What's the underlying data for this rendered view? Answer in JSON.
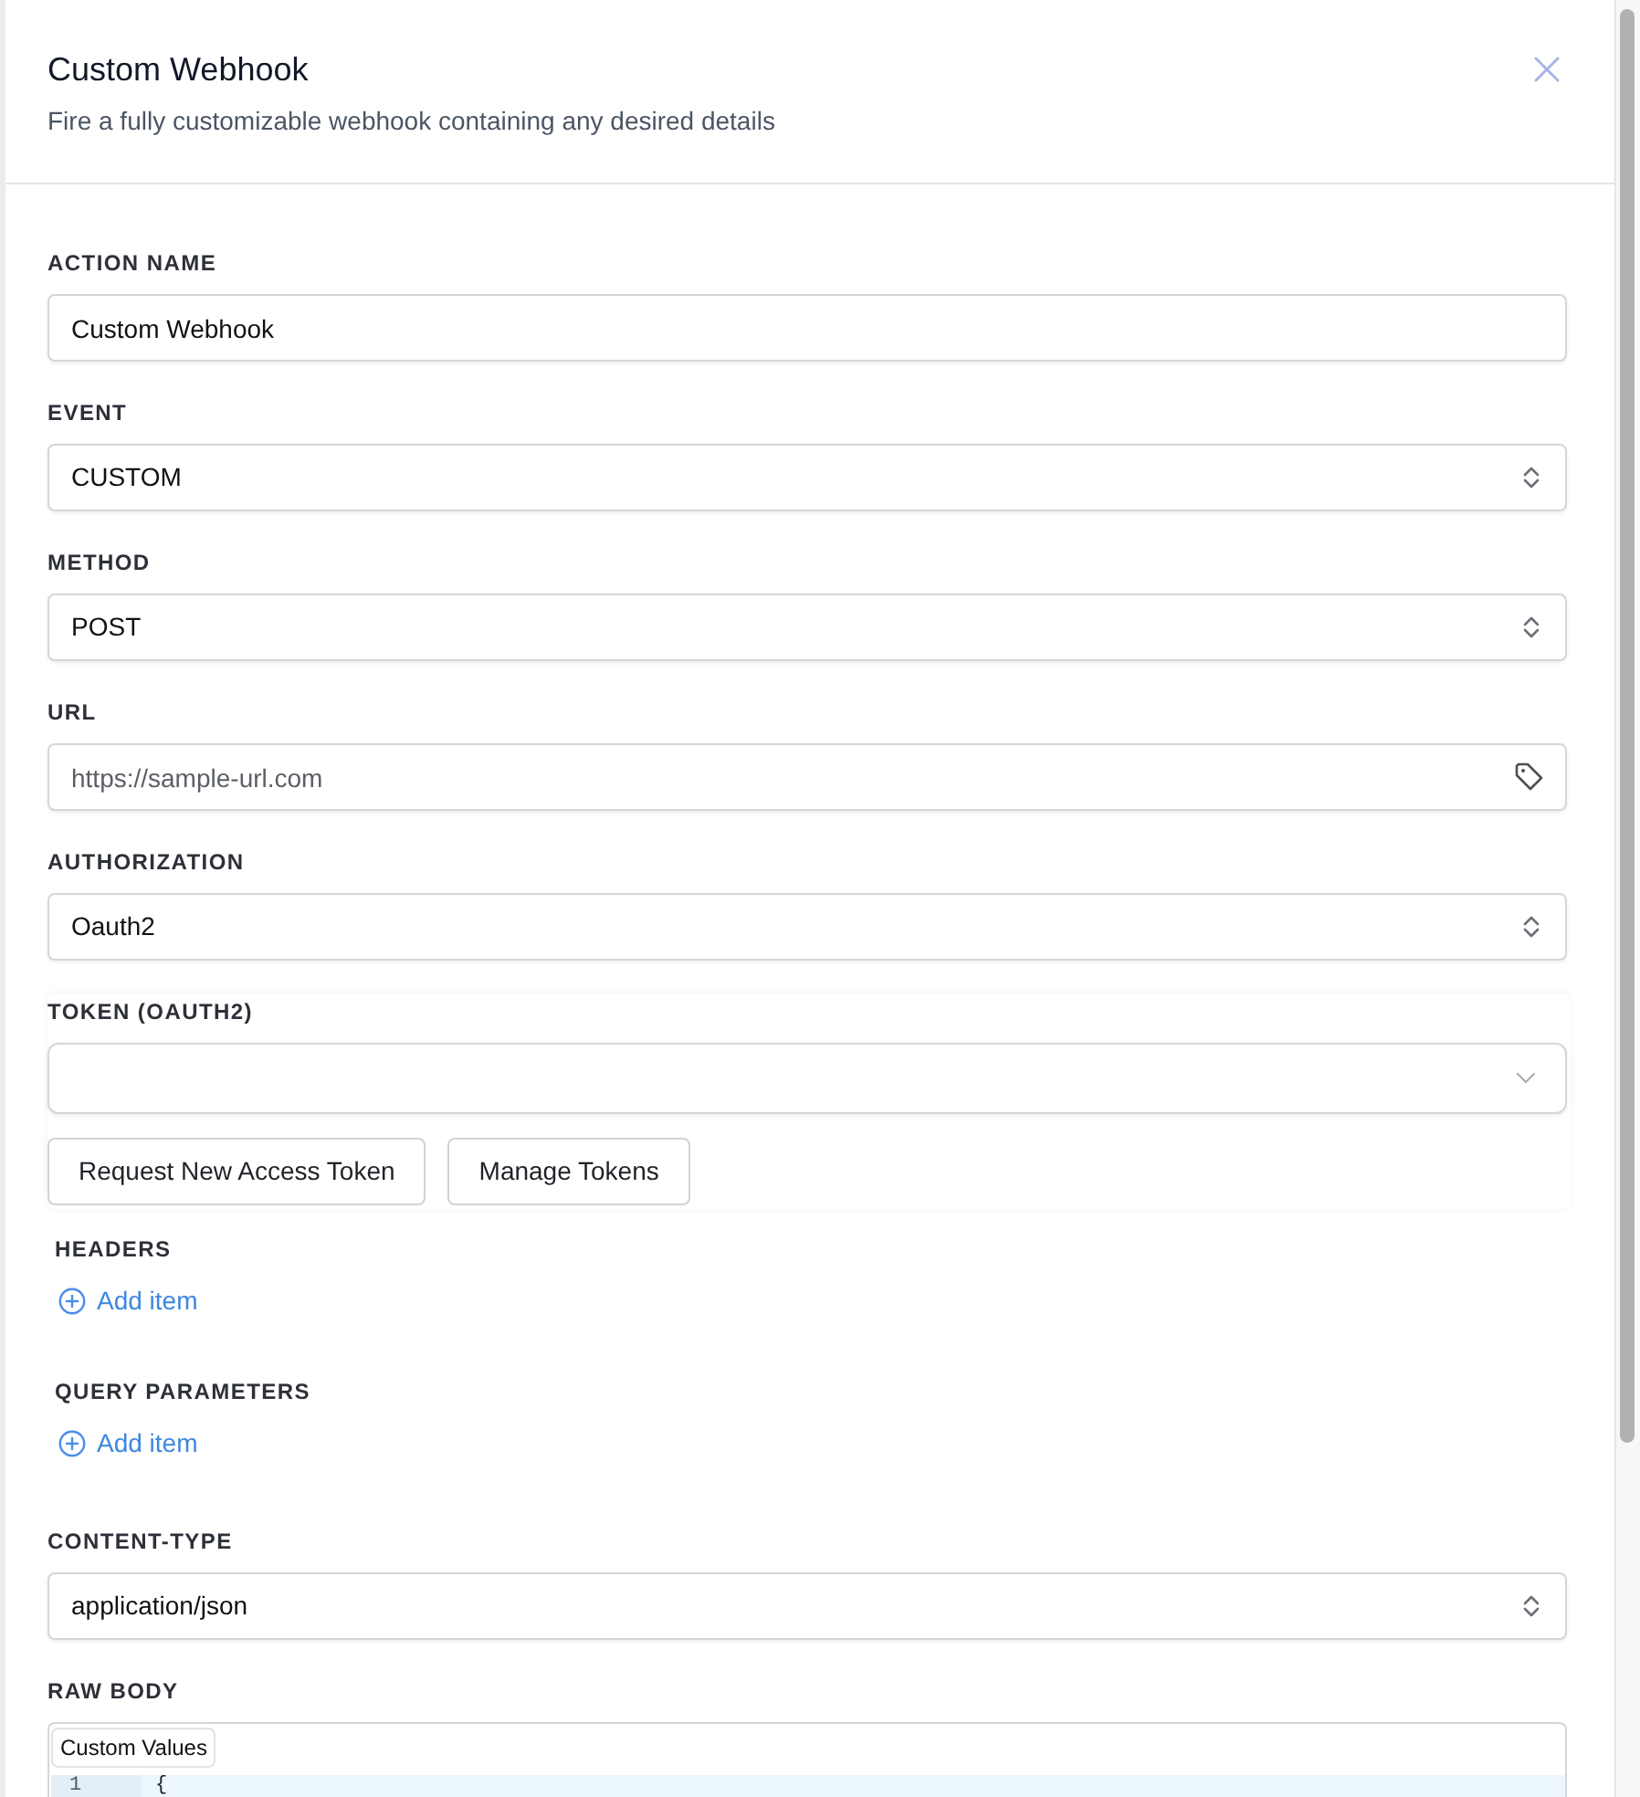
{
  "header": {
    "title": "Custom Webhook",
    "subtitle": "Fire a fully customizable webhook containing any desired details"
  },
  "fields": [
    {
      "kind": "text",
      "label": "ACTION NAME",
      "value": "Custom Webhook"
    },
    {
      "kind": "select",
      "label": "EVENT",
      "value": "CUSTOM"
    },
    {
      "kind": "select",
      "label": "METHOD",
      "value": "POST"
    },
    {
      "kind": "url",
      "label": "URL",
      "placeholder": "https://sample-url.com"
    },
    {
      "kind": "select",
      "label": "AUTHORIZATION",
      "value": "Oauth2"
    },
    {
      "kind": "token",
      "label": "TOKEN (OAUTH2)",
      "buttons": [
        "Request New Access Token",
        "Manage Tokens"
      ]
    },
    {
      "kind": "list",
      "label": "HEADERS",
      "add_label": "Add item"
    },
    {
      "kind": "list",
      "label": "QUERY PARAMETERS",
      "add_label": "Add item"
    },
    {
      "kind": "select",
      "label": "CONTENT-TYPE",
      "value": "application/json"
    },
    {
      "kind": "code",
      "label": "RAW BODY",
      "toolbar_button": "Custom Values",
      "lines": [
        {
          "number": "1",
          "text": "{",
          "active": true
        }
      ]
    }
  ]
}
